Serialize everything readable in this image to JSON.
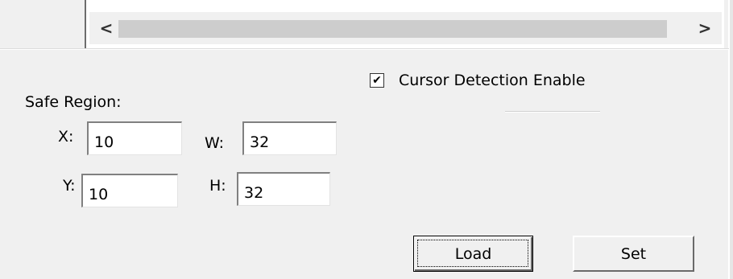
{
  "list": {
    "scroll_left_glyph": "<",
    "scroll_right_glyph": ">"
  },
  "safe_region": {
    "label": "Safe Region:",
    "x_label": "X:",
    "x_value": "10",
    "y_label": "Y:",
    "y_value": "10",
    "w_label": "W:",
    "w_value": "32",
    "h_label": "H:",
    "h_value": "32"
  },
  "cursor_detection": {
    "label": "Cursor Detection Enable",
    "checked": true,
    "check_glyph": "✔"
  },
  "buttons": {
    "load_label": "Load",
    "set_label": "Set"
  }
}
